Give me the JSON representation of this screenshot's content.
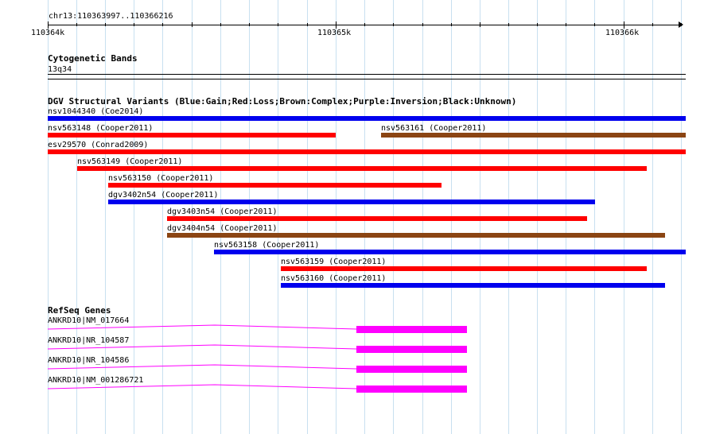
{
  "region": "chr13:110363997..110366216",
  "ruler": {
    "labels": [
      "110364k",
      "110365k",
      "110366k"
    ]
  },
  "cytoband": {
    "title": "Cytogenetic Bands",
    "band": "13q34"
  },
  "dgv": {
    "title": "DGV Structural Variants (Blue:Gain;Red:Loss;Brown:Complex;Purple:Inversion;Black:Unknown)",
    "colors": {
      "gain": "#0000ee",
      "loss": "#ff0000",
      "complex": "#8b4513"
    },
    "variants": [
      {
        "label": "nsv1044340 (Coe2014)",
        "type": "gain"
      },
      {
        "label": "nsv563148 (Cooper2011)",
        "type": "loss"
      },
      {
        "label": "nsv563161 (Cooper2011)",
        "type": "complex"
      },
      {
        "label": "esv29570 (Conrad2009)",
        "type": "loss"
      },
      {
        "label": "nsv563149 (Cooper2011)",
        "type": "loss"
      },
      {
        "label": "nsv563150 (Cooper2011)",
        "type": "loss"
      },
      {
        "label": "dgv3402n54 (Cooper2011)",
        "type": "gain"
      },
      {
        "label": "dgv3403n54 (Cooper2011)",
        "type": "loss"
      },
      {
        "label": "dgv3404n54 (Cooper2011)",
        "type": "complex"
      },
      {
        "label": "nsv563158 (Cooper2011)",
        "type": "gain"
      },
      {
        "label": "nsv563159 (Cooper2011)",
        "type": "loss"
      },
      {
        "label": "nsv563160 (Cooper2011)",
        "type": "gain"
      }
    ]
  },
  "refseq": {
    "title": "RefSeq Genes",
    "color": "#ff00ff",
    "genes": [
      {
        "label": "ANKRD10|NM_017664"
      },
      {
        "label": "ANKRD10|NR_104587"
      },
      {
        "label": "ANKRD10|NR_104586"
      },
      {
        "label": "ANKRD10|NM_001286721"
      }
    ]
  }
}
